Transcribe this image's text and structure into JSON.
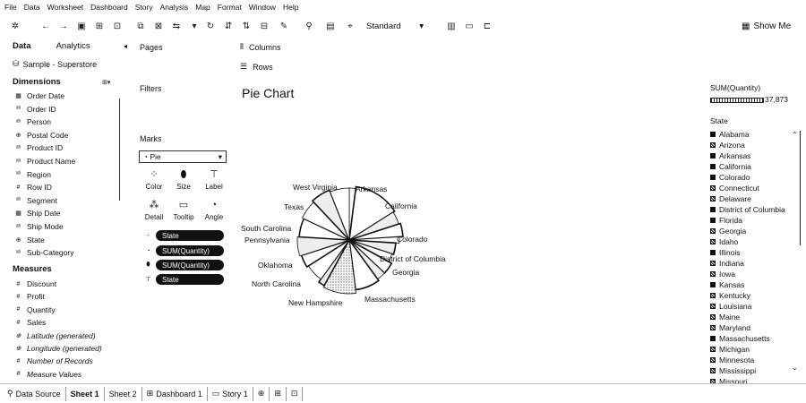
{
  "menu": [
    "File",
    "Data",
    "Worksheet",
    "Dashboard",
    "Story",
    "Analysis",
    "Map",
    "Format",
    "Window",
    "Help"
  ],
  "toolbar": {
    "fit_value": "Standard",
    "show_me_label": "Show Me"
  },
  "data_pane": {
    "tab_data": "Data",
    "tab_analytics": "Analytics",
    "datasource": "Sample - Superstore",
    "dimensions_title": "Dimensions",
    "dimensions": [
      {
        "icon": "date",
        "label": "Order Date"
      },
      {
        "icon": "abc",
        "label": "Order ID"
      },
      {
        "icon": "abc",
        "label": "Person"
      },
      {
        "icon": "geo",
        "label": "Postal Code"
      },
      {
        "icon": "abc",
        "label": "Product ID"
      },
      {
        "icon": "abc",
        "label": "Product Name"
      },
      {
        "icon": "abc",
        "label": "Region"
      },
      {
        "icon": "num",
        "label": "Row ID"
      },
      {
        "icon": "abc",
        "label": "Segment"
      },
      {
        "icon": "date",
        "label": "Ship Date"
      },
      {
        "icon": "abc",
        "label": "Ship Mode"
      },
      {
        "icon": "geo",
        "label": "State"
      },
      {
        "icon": "abc",
        "label": "Sub-Category"
      }
    ],
    "measures_title": "Measures",
    "measures": [
      {
        "icon": "num",
        "label": "Discount",
        "italic": false
      },
      {
        "icon": "num",
        "label": "Profit",
        "italic": false
      },
      {
        "icon": "num",
        "label": "Quantity",
        "italic": false
      },
      {
        "icon": "num",
        "label": "Sales",
        "italic": false
      },
      {
        "icon": "geo",
        "label": "Latitude (generated)",
        "italic": true
      },
      {
        "icon": "geo",
        "label": "Longitude (generated)",
        "italic": true
      },
      {
        "icon": "num",
        "label": "Number of Records",
        "italic": true
      },
      {
        "icon": "num",
        "label": "Measure Values",
        "italic": true
      }
    ]
  },
  "shelves": {
    "pages": "Pages",
    "filters": "Filters",
    "marks": "Marks",
    "columns": "Columns",
    "rows": "Rows",
    "mark_type": "Pie",
    "mark_buttons": [
      "Color",
      "Size",
      "Label",
      "Detail",
      "Tooltip",
      "Angle"
    ],
    "pills": [
      "State",
      "SUM(Quantity)",
      "SUM(Quantity)",
      "State"
    ]
  },
  "view": {
    "title": "Pie Chart"
  },
  "chart_data": {
    "type": "pie",
    "title": "Pie Chart",
    "measure": "SUM(Quantity)",
    "labels_shown": [
      "West Virginia",
      "Arkansas",
      "California",
      "Texas",
      "South Carolina",
      "Pennsylvania",
      "Colorado",
      "District of Columbia",
      "Oklahoma",
      "Georgia",
      "North Carolina",
      "New Hampshire",
      "Massachusetts"
    ]
  },
  "legend": {
    "size_title": "SUM(Quantity)",
    "size_max": "37,873",
    "color_title": "State",
    "states": [
      "Alabama",
      "Arizona",
      "Arkansas",
      "California",
      "Colorado",
      "Connecticut",
      "Delaware",
      "District of Columbia",
      "Florida",
      "Georgia",
      "Idaho",
      "Illinois",
      "Indiana",
      "Iowa",
      "Kansas",
      "Kentucky",
      "Louisiana",
      "Maine",
      "Maryland",
      "Massachusetts",
      "Michigan",
      "Minnesota",
      "Mississippi",
      "Missouri"
    ]
  },
  "sheet_tabs": [
    "Data Source",
    "Sheet 1",
    "Sheet 2",
    "Dashboard 1",
    "Story 1"
  ]
}
